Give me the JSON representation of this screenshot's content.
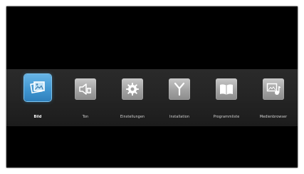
{
  "main_menu": {
    "items": [
      {
        "label": "Bild",
        "icon": "picture-icon",
        "selected": true
      },
      {
        "label": "Ton",
        "icon": "speaker-icon",
        "selected": false
      },
      {
        "label": "Einstellungen",
        "icon": "gear-icon",
        "selected": false
      },
      {
        "label": "Installation",
        "icon": "antenna-icon",
        "selected": false
      },
      {
        "label": "Programmliste",
        "icon": "book-icon",
        "selected": false
      },
      {
        "label": "Medienbrowser",
        "icon": "media-icon",
        "selected": false
      }
    ]
  },
  "colors": {
    "background": "#000000",
    "menu_bar": "#262626",
    "icon_tile": "#a2a2a2",
    "selected_tile": "#3f95d0",
    "label_text": "#d6d6d6"
  }
}
